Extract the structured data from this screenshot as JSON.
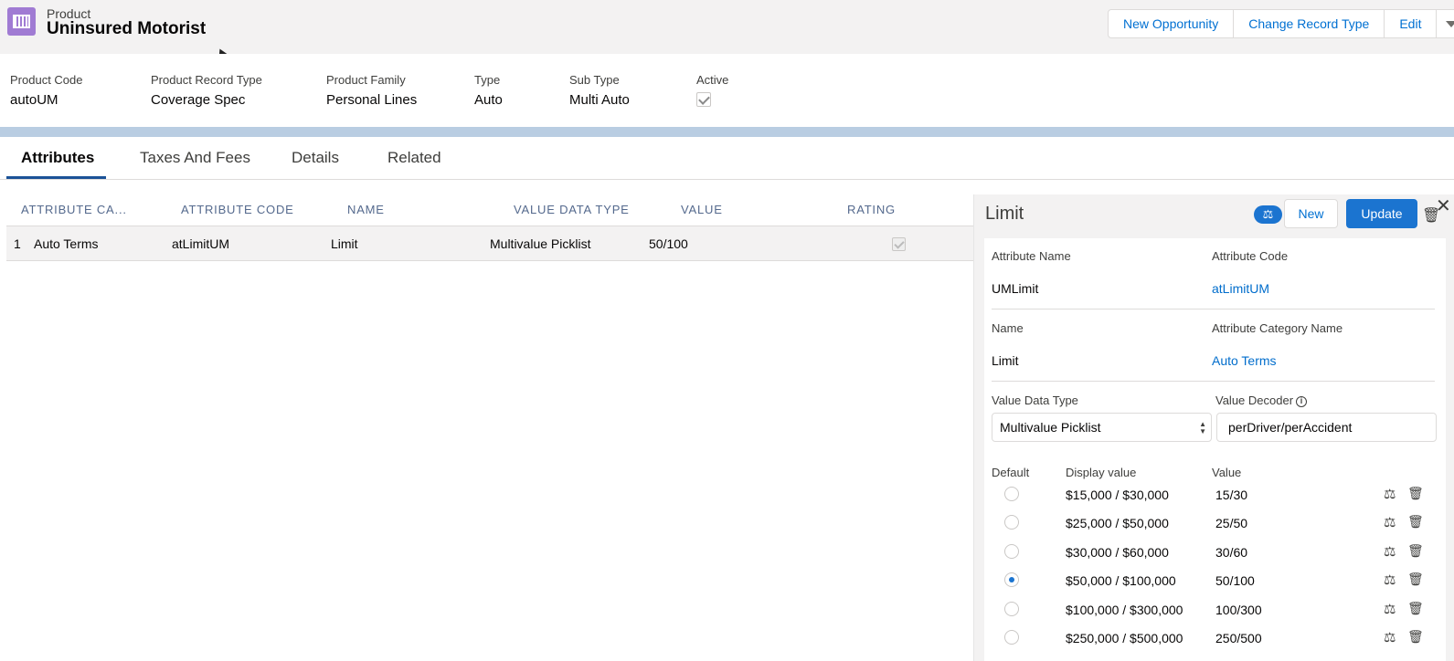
{
  "header": {
    "object_type": "Product",
    "record_name": "Uninsured Motorist",
    "actions": [
      "New Opportunity",
      "Change Record Type",
      "Edit"
    ]
  },
  "highlights": [
    {
      "label": "Product Code",
      "value": "autoUM"
    },
    {
      "label": "Product Record Type",
      "value": "Coverage Spec"
    },
    {
      "label": "Product Family",
      "value": "Personal Lines"
    },
    {
      "label": "Type",
      "value": "Auto"
    },
    {
      "label": "Sub Type",
      "value": "Multi Auto"
    },
    {
      "label": "Active",
      "value": "",
      "checked": true
    }
  ],
  "tabs": [
    "Attributes",
    "Taxes And Fees",
    "Details",
    "Related"
  ],
  "active_tab": "Attributes",
  "table": {
    "columns": [
      "ATTRIBUTE CA...",
      "ATTRIBUTE CODE",
      "NAME",
      "VALUE DATA TYPE",
      "VALUE",
      "RATING"
    ],
    "rows": [
      {
        "index": "1",
        "category": "Auto Terms",
        "code": "atLimitUM",
        "name": "Limit",
        "data_type": "Multivalue Picklist",
        "value": "50/100",
        "rating": false
      }
    ]
  },
  "panel": {
    "title": "Limit",
    "new_label": "New",
    "update_label": "Update",
    "rule_icon": "⚖",
    "fields": {
      "attribute_name_label": "Attribute Name",
      "attribute_name": "UMLimit",
      "attribute_code_label": "Attribute Code",
      "attribute_code": "atLimitUM",
      "name_label": "Name",
      "name": "Limit",
      "category_label": "Attribute Category Name",
      "category": "Auto Terms",
      "value_data_type_label": "Value Data Type",
      "value_data_type": "Multivalue Picklist",
      "value_decoder_label": "Value Decoder",
      "value_decoder": "perDriver/perAccident"
    },
    "options_headers": {
      "default": "Default",
      "display": "Display value",
      "value": "Value"
    },
    "options": [
      {
        "display": "$15,000 / $30,000",
        "value": "15/30",
        "default": false
      },
      {
        "display": "$25,000 / $50,000",
        "value": "25/50",
        "default": false
      },
      {
        "display": "$30,000 / $60,000",
        "value": "30/60",
        "default": false
      },
      {
        "display": "$50,000 / $100,000",
        "value": "50/100",
        "default": true
      },
      {
        "display": "$100,000 / $300,000",
        "value": "100/300",
        "default": false
      },
      {
        "display": "$250,000 / $500,000",
        "value": "250/500",
        "default": false
      }
    ]
  },
  "colors": {
    "brand": "#1b74d0",
    "link": "#006dcc",
    "icon": "#a07bd3"
  }
}
